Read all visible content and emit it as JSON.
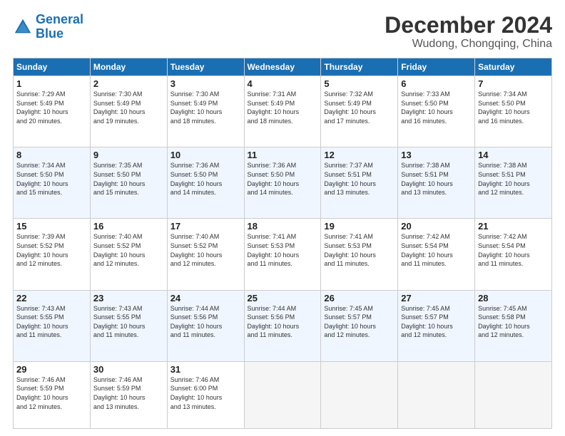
{
  "logo": {
    "text1": "General",
    "text2": "Blue"
  },
  "title": "December 2024",
  "subtitle": "Wudong, Chongqing, China",
  "days_of_week": [
    "Sunday",
    "Monday",
    "Tuesday",
    "Wednesday",
    "Thursday",
    "Friday",
    "Saturday"
  ],
  "weeks": [
    [
      {
        "day": "1",
        "info": "Sunrise: 7:29 AM\nSunset: 5:49 PM\nDaylight: 10 hours\nand 20 minutes."
      },
      {
        "day": "2",
        "info": "Sunrise: 7:30 AM\nSunset: 5:49 PM\nDaylight: 10 hours\nand 19 minutes."
      },
      {
        "day": "3",
        "info": "Sunrise: 7:30 AM\nSunset: 5:49 PM\nDaylight: 10 hours\nand 18 minutes."
      },
      {
        "day": "4",
        "info": "Sunrise: 7:31 AM\nSunset: 5:49 PM\nDaylight: 10 hours\nand 18 minutes."
      },
      {
        "day": "5",
        "info": "Sunrise: 7:32 AM\nSunset: 5:49 PM\nDaylight: 10 hours\nand 17 minutes."
      },
      {
        "day": "6",
        "info": "Sunrise: 7:33 AM\nSunset: 5:50 PM\nDaylight: 10 hours\nand 16 minutes."
      },
      {
        "day": "7",
        "info": "Sunrise: 7:34 AM\nSunset: 5:50 PM\nDaylight: 10 hours\nand 16 minutes."
      }
    ],
    [
      {
        "day": "8",
        "info": "Sunrise: 7:34 AM\nSunset: 5:50 PM\nDaylight: 10 hours\nand 15 minutes."
      },
      {
        "day": "9",
        "info": "Sunrise: 7:35 AM\nSunset: 5:50 PM\nDaylight: 10 hours\nand 15 minutes."
      },
      {
        "day": "10",
        "info": "Sunrise: 7:36 AM\nSunset: 5:50 PM\nDaylight: 10 hours\nand 14 minutes."
      },
      {
        "day": "11",
        "info": "Sunrise: 7:36 AM\nSunset: 5:50 PM\nDaylight: 10 hours\nand 14 minutes."
      },
      {
        "day": "12",
        "info": "Sunrise: 7:37 AM\nSunset: 5:51 PM\nDaylight: 10 hours\nand 13 minutes."
      },
      {
        "day": "13",
        "info": "Sunrise: 7:38 AM\nSunset: 5:51 PM\nDaylight: 10 hours\nand 13 minutes."
      },
      {
        "day": "14",
        "info": "Sunrise: 7:38 AM\nSunset: 5:51 PM\nDaylight: 10 hours\nand 12 minutes."
      }
    ],
    [
      {
        "day": "15",
        "info": "Sunrise: 7:39 AM\nSunset: 5:52 PM\nDaylight: 10 hours\nand 12 minutes."
      },
      {
        "day": "16",
        "info": "Sunrise: 7:40 AM\nSunset: 5:52 PM\nDaylight: 10 hours\nand 12 minutes."
      },
      {
        "day": "17",
        "info": "Sunrise: 7:40 AM\nSunset: 5:52 PM\nDaylight: 10 hours\nand 12 minutes."
      },
      {
        "day": "18",
        "info": "Sunrise: 7:41 AM\nSunset: 5:53 PM\nDaylight: 10 hours\nand 11 minutes."
      },
      {
        "day": "19",
        "info": "Sunrise: 7:41 AM\nSunset: 5:53 PM\nDaylight: 10 hours\nand 11 minutes."
      },
      {
        "day": "20",
        "info": "Sunrise: 7:42 AM\nSunset: 5:54 PM\nDaylight: 10 hours\nand 11 minutes."
      },
      {
        "day": "21",
        "info": "Sunrise: 7:42 AM\nSunset: 5:54 PM\nDaylight: 10 hours\nand 11 minutes."
      }
    ],
    [
      {
        "day": "22",
        "info": "Sunrise: 7:43 AM\nSunset: 5:55 PM\nDaylight: 10 hours\nand 11 minutes."
      },
      {
        "day": "23",
        "info": "Sunrise: 7:43 AM\nSunset: 5:55 PM\nDaylight: 10 hours\nand 11 minutes."
      },
      {
        "day": "24",
        "info": "Sunrise: 7:44 AM\nSunset: 5:56 PM\nDaylight: 10 hours\nand 11 minutes."
      },
      {
        "day": "25",
        "info": "Sunrise: 7:44 AM\nSunset: 5:56 PM\nDaylight: 10 hours\nand 11 minutes."
      },
      {
        "day": "26",
        "info": "Sunrise: 7:45 AM\nSunset: 5:57 PM\nDaylight: 10 hours\nand 12 minutes."
      },
      {
        "day": "27",
        "info": "Sunrise: 7:45 AM\nSunset: 5:57 PM\nDaylight: 10 hours\nand 12 minutes."
      },
      {
        "day": "28",
        "info": "Sunrise: 7:45 AM\nSunset: 5:58 PM\nDaylight: 10 hours\nand 12 minutes."
      }
    ],
    [
      {
        "day": "29",
        "info": "Sunrise: 7:46 AM\nSunset: 5:59 PM\nDaylight: 10 hours\nand 12 minutes."
      },
      {
        "day": "30",
        "info": "Sunrise: 7:46 AM\nSunset: 5:59 PM\nDaylight: 10 hours\nand 13 minutes."
      },
      {
        "day": "31",
        "info": "Sunrise: 7:46 AM\nSunset: 6:00 PM\nDaylight: 10 hours\nand 13 minutes."
      },
      {
        "day": "",
        "info": ""
      },
      {
        "day": "",
        "info": ""
      },
      {
        "day": "",
        "info": ""
      },
      {
        "day": "",
        "info": ""
      }
    ]
  ]
}
